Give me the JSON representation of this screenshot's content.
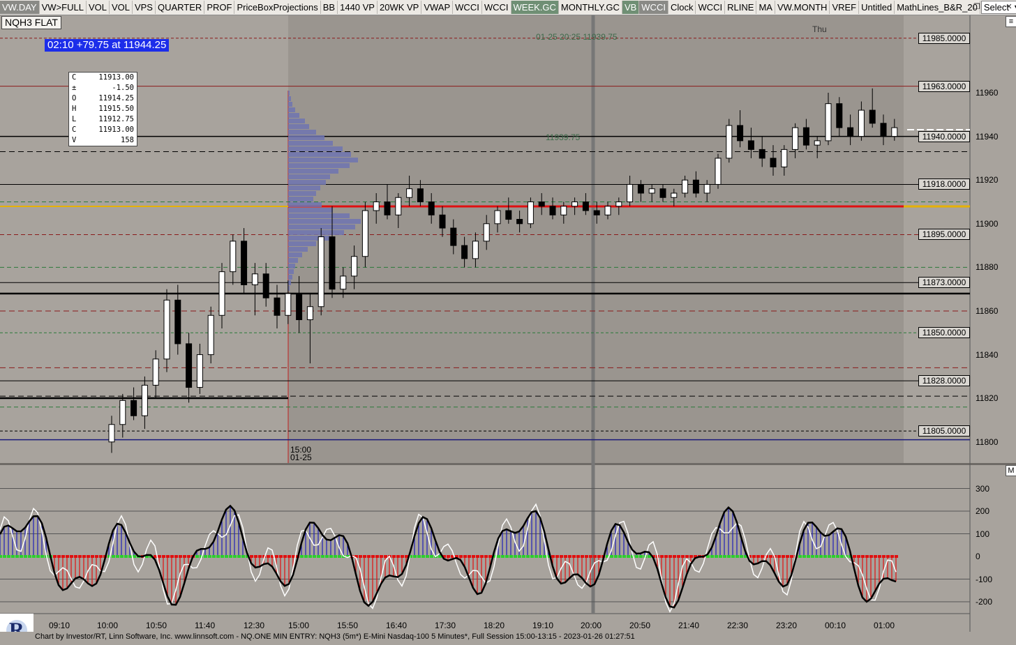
{
  "toolbar": {
    "buttons": [
      {
        "label": "VW.DAY",
        "state": "active"
      },
      {
        "label": "VW>FULL",
        "state": "normal"
      },
      {
        "label": "VOL",
        "state": "normal"
      },
      {
        "label": "VOL",
        "state": "normal"
      },
      {
        "label": "VPS",
        "state": "normal"
      },
      {
        "label": "QUARTER",
        "state": "normal"
      },
      {
        "label": "PROF",
        "state": "normal"
      },
      {
        "label": "PriceBoxProjections",
        "state": "normal"
      },
      {
        "label": "BB",
        "state": "normal"
      },
      {
        "label": "1440 VP",
        "state": "normal"
      },
      {
        "label": "20WK VP",
        "state": "normal"
      },
      {
        "label": "VWAP",
        "state": "normal"
      },
      {
        "label": "WCCI",
        "state": "normal"
      },
      {
        "label": "WCCI",
        "state": "normal"
      },
      {
        "label": "WEEK.GC",
        "state": "green"
      },
      {
        "label": "MONTHLY.GC",
        "state": "normal"
      },
      {
        "label": "VB",
        "state": "green"
      },
      {
        "label": "WCCI",
        "state": "active"
      },
      {
        "label": "Clock",
        "state": "normal"
      },
      {
        "label": "WCCI",
        "state": "normal"
      },
      {
        "label": "RLINE",
        "state": "normal"
      },
      {
        "label": "MA",
        "state": "normal"
      },
      {
        "label": "VW.MONTH",
        "state": "normal"
      },
      {
        "label": "VREF",
        "state": "normal"
      },
      {
        "label": "Untitled",
        "state": "normal"
      },
      {
        "label": "MathLines_B&R_20",
        "state": "normal"
      }
    ],
    "select_value": "Select"
  },
  "window_buttons": {
    "restore": "❐",
    "close": "✕"
  },
  "symbol_label": "NQH3 FLAT",
  "alert_text": "02:10  +79.75 at 11944.25",
  "ohlc_box": [
    {
      "k": "C",
      "v": "11913.00"
    },
    {
      "k": "±",
      "v": "-1.50"
    },
    {
      "k": "O",
      "v": "11914.25"
    },
    {
      "k": "H",
      "v": "11915.50"
    },
    {
      "k": "L",
      "v": "11912.75"
    },
    {
      "k": "C",
      "v": "11913.00"
    },
    {
      "k": "V",
      "v": "158"
    }
  ],
  "day_label": "Thu",
  "annotations": {
    "top_note": "01-25 20:25  11939.75",
    "mid_note": "11939.75"
  },
  "session_start": {
    "time": "15:00",
    "date": "01-25"
  },
  "price_tags": [
    "11985.0000",
    "11963.0000",
    "11940.0000",
    "11918.0000",
    "11895.0000",
    "11873.0000",
    "11850.0000",
    "11828.0000",
    "11805.0000"
  ],
  "price_axis": [
    "11960",
    "11940",
    "11920",
    "11900",
    "11880",
    "11860",
    "11840",
    "11820",
    "11800"
  ],
  "indicator_axis": [
    "300",
    "200",
    "100",
    "0",
    "-100",
    "-200"
  ],
  "indicator_marker": "M",
  "time_axis": [
    "09:10",
    "10:00",
    "10:50",
    "11:40",
    "12:30",
    "15:00",
    "15:50",
    "16:40",
    "17:30",
    "18:20",
    "19:10",
    "20:00",
    "20:50",
    "21:40",
    "22:30",
    "23:20",
    "00:10",
    "01:00"
  ],
  "footer_text": "Chart by Investor/RT, Linn Software, Inc. www.linnsoft.com - NQ.ONE MIN ENTRY: NQH3 (5m*) E-Mini Nasdaq-100 5 Minutes*, Full Session 15:00-13:15 - 2023-01-26 01:27:51",
  "logo_letter": "R",
  "colors": {
    "background": "#a8a39d",
    "session_shade": "#9a958f",
    "profile": "#6f74b2",
    "poc_line": "#e01010",
    "vwap_line": "#e5b100",
    "bull_candle": "#ffffff",
    "bear_candle": "#000000",
    "cci_up": "#2020b8",
    "cci_down": "#e01010",
    "zero_pos": "#2bd02b",
    "zero_neg": "#e01010"
  },
  "chart_data": {
    "type": "candlestick",
    "symbol": "NQH3",
    "interval": "5 Minutes",
    "price_range": [
      11795,
      11995
    ],
    "candles": [
      [
        11800,
        11812,
        11795,
        11808
      ],
      [
        11808,
        11822,
        11802,
        11819
      ],
      [
        11819,
        11825,
        11810,
        11812
      ],
      [
        11812,
        11830,
        11806,
        11826
      ],
      [
        11826,
        11842,
        11820,
        11838
      ],
      [
        11838,
        11870,
        11832,
        11865
      ],
      [
        11865,
        11872,
        11840,
        11845
      ],
      [
        11845,
        11850,
        11818,
        11825
      ],
      [
        11825,
        11845,
        11822,
        11840
      ],
      [
        11840,
        11862,
        11836,
        11858
      ],
      [
        11858,
        11882,
        11852,
        11878
      ],
      [
        11878,
        11895,
        11872,
        11892
      ],
      [
        11892,
        11898,
        11868,
        11872
      ],
      [
        11872,
        11882,
        11858,
        11877
      ],
      [
        11877,
        11882,
        11862,
        11866
      ],
      [
        11866,
        11872,
        11852,
        11858
      ],
      [
        11858,
        11874,
        11854,
        11868
      ],
      [
        11868,
        11876,
        11850,
        11856
      ],
      [
        11856,
        11868,
        11836,
        11862
      ],
      [
        11862,
        11898,
        11858,
        11894
      ],
      [
        11894,
        11908,
        11866,
        11870
      ],
      [
        11870,
        11880,
        11866,
        11876
      ],
      [
        11876,
        11890,
        11870,
        11885
      ],
      [
        11885,
        11910,
        11880,
        11906
      ],
      [
        11906,
        11914,
        11900,
        11910
      ],
      [
        11910,
        11918,
        11902,
        11904
      ],
      [
        11904,
        11914,
        11898,
        11912
      ],
      [
        11912,
        11922,
        11908,
        11916
      ],
      [
        11916,
        11920,
        11908,
        11910
      ],
      [
        11910,
        11914,
        11900,
        11904
      ],
      [
        11904,
        11908,
        11894,
        11898
      ],
      [
        11898,
        11902,
        11886,
        11890
      ],
      [
        11890,
        11894,
        11880,
        11884
      ],
      [
        11884,
        11896,
        11880,
        11892
      ],
      [
        11892,
        11904,
        11888,
        11900
      ],
      [
        11900,
        11908,
        11896,
        11906
      ],
      [
        11906,
        11912,
        11900,
        11902
      ],
      [
        11902,
        11906,
        11896,
        11900
      ],
      [
        11900,
        11912,
        11898,
        11910
      ],
      [
        11910,
        11914,
        11904,
        11908
      ],
      [
        11908,
        11912,
        11902,
        11904
      ],
      [
        11904,
        11910,
        11900,
        11908
      ],
      [
        11908,
        11912,
        11904,
        11910
      ],
      [
        11910,
        11914,
        11904,
        11906
      ],
      [
        11906,
        11910,
        11900,
        11904
      ],
      [
        11904,
        11910,
        11902,
        11908
      ],
      [
        11908,
        11912,
        11904,
        11910
      ],
      [
        11910,
        11922,
        11908,
        11918
      ],
      [
        11918,
        11920,
        11910,
        11914
      ],
      [
        11914,
        11918,
        11910,
        11916
      ],
      [
        11916,
        11918,
        11910,
        11912
      ],
      [
        11912,
        11916,
        11908,
        11914
      ],
      [
        11914,
        11922,
        11912,
        11920
      ],
      [
        11920,
        11924,
        11912,
        11914
      ],
      [
        11914,
        11920,
        11910,
        11918
      ],
      [
        11918,
        11932,
        11916,
        11930
      ],
      [
        11930,
        11948,
        11928,
        11945
      ],
      [
        11945,
        11952,
        11935,
        11938
      ],
      [
        11938,
        11944,
        11930,
        11934
      ],
      [
        11934,
        11940,
        11926,
        11930
      ],
      [
        11930,
        11936,
        11922,
        11926
      ],
      [
        11926,
        11936,
        11922,
        11934
      ],
      [
        11934,
        11946,
        11930,
        11944
      ],
      [
        11944,
        11948,
        11934,
        11936
      ],
      [
        11936,
        11940,
        11930,
        11938
      ],
      [
        11938,
        11960,
        11936,
        11955
      ],
      [
        11955,
        11958,
        11940,
        11944
      ],
      [
        11944,
        11950,
        11936,
        11940
      ],
      [
        11940,
        11956,
        11938,
        11952
      ],
      [
        11952,
        11962,
        11944,
        11946
      ],
      [
        11946,
        11950,
        11936,
        11940
      ],
      [
        11940,
        11948,
        11938,
        11944
      ]
    ]
  }
}
